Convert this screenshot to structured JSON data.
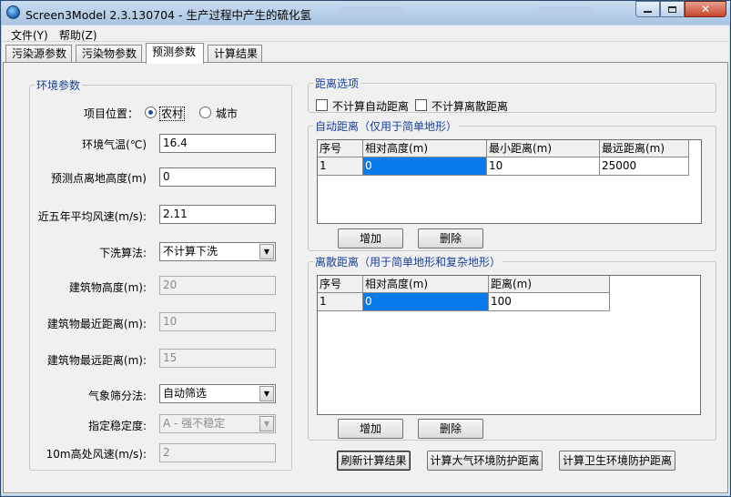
{
  "window": {
    "title": "Screen3Model 2.3.130704 - 生产过程中产生的硫化氢",
    "minimize_icon": "minimize-icon",
    "maximize_icon": "maximize-icon",
    "close_icon": "close-icon"
  },
  "menu": {
    "file": "文件(Y)",
    "help": "帮助(Z)"
  },
  "tabs": [
    "污染源参数",
    "污染物参数",
    "预测参数",
    "计算结果"
  ],
  "active_tab": "预测参数",
  "env": {
    "group_title": "环境参数",
    "location_label": "项目位置：",
    "location_options": [
      "农村",
      "城市"
    ],
    "location_selected": "农村",
    "temp_label": "环境气温(℃)",
    "temp_value": "16.4",
    "height_label": "预测点离地高度(m)",
    "height_value": "0",
    "wind_label": "近五年平均风速(m/s):",
    "wind_value": "2.11",
    "downwash_label": "下洗算法:",
    "downwash_value": "不计算下洗",
    "bldg_height_label": "建筑物高度(m):",
    "bldg_height_value": "20",
    "bldg_near_label": "建筑物最近距离(m):",
    "bldg_near_value": "10",
    "bldg_far_label": "建筑物最远距离(m):",
    "bldg_far_value": "15",
    "met_label": "气象筛分法:",
    "met_value": "自动筛选",
    "stab_label": "指定稳定度:",
    "stab_value": "A - 强不稳定",
    "wind10_label": "10m高处风速(m/s):",
    "wind10_value": "2"
  },
  "distance_options": {
    "group_title": "距离选项",
    "no_auto": "不计算自动距离",
    "no_discrete": "不计算离散距离"
  },
  "auto_distance": {
    "group_title": "自动距离（仅用于简单地形）",
    "columns": [
      "序号",
      "相对高度(m)",
      "最小距离(m)",
      "最远距离(m)"
    ],
    "rows": [
      [
        "1",
        "0",
        "10",
        "25000"
      ]
    ],
    "add": "增加",
    "delete": "删除"
  },
  "discrete_distance": {
    "group_title": "离散距离（用于简单地形和复杂地形）",
    "columns": [
      "序号",
      "相对高度(m)",
      "距离(m)"
    ],
    "rows": [
      [
        "1",
        "0",
        "100"
      ]
    ],
    "add": "增加",
    "delete": "删除"
  },
  "actions": {
    "refresh": "刷新计算结果",
    "atmos": "计算大气环境防护距离",
    "health": "计算卫生环境防护距离"
  },
  "colors": {
    "selection": "#0a7bea",
    "group_title": "#1a3f9a",
    "titlebar": "#bcd2ea"
  }
}
